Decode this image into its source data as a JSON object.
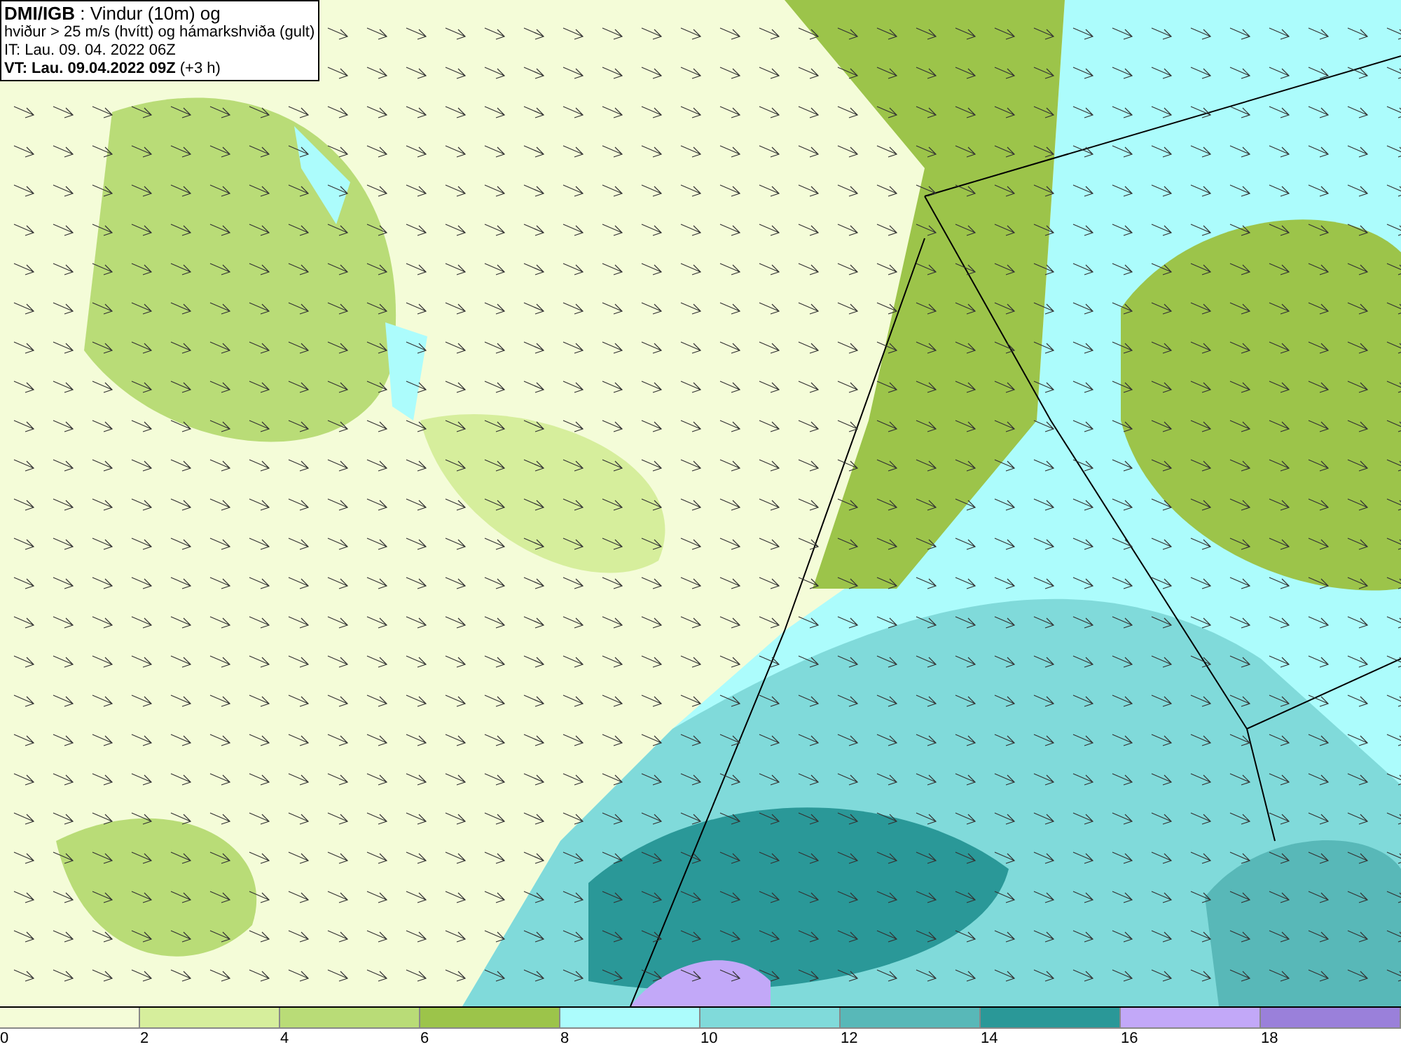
{
  "title_box": {
    "lines": [
      "**DMI/IGB** : Vindur (10m) og",
      "hviður > 25 m/s (hvítt) og hámarkshviða (gult)",
      "IT: Lau. 09. 04. 2022 06Z",
      "**VT: Lau. 09.04.2022 09Z** (+3 h)"
    ]
  },
  "legend": {
    "swatches": [
      {
        "color": "#f4fcd8"
      },
      {
        "color": "#d6ee9c"
      },
      {
        "color": "#b9dc77"
      },
      {
        "color": "#9cc44a"
      },
      {
        "color": "#acfcfc"
      },
      {
        "color": "#80dada"
      },
      {
        "color": "#58b8b8"
      },
      {
        "color": "#2a9898"
      },
      {
        "color": "#c2a8f8"
      },
      {
        "color": "#9a80da"
      }
    ],
    "ticks": [
      "0",
      "2",
      "4",
      "6",
      "8",
      "10",
      "12",
      "14",
      "16",
      "18"
    ]
  }
}
